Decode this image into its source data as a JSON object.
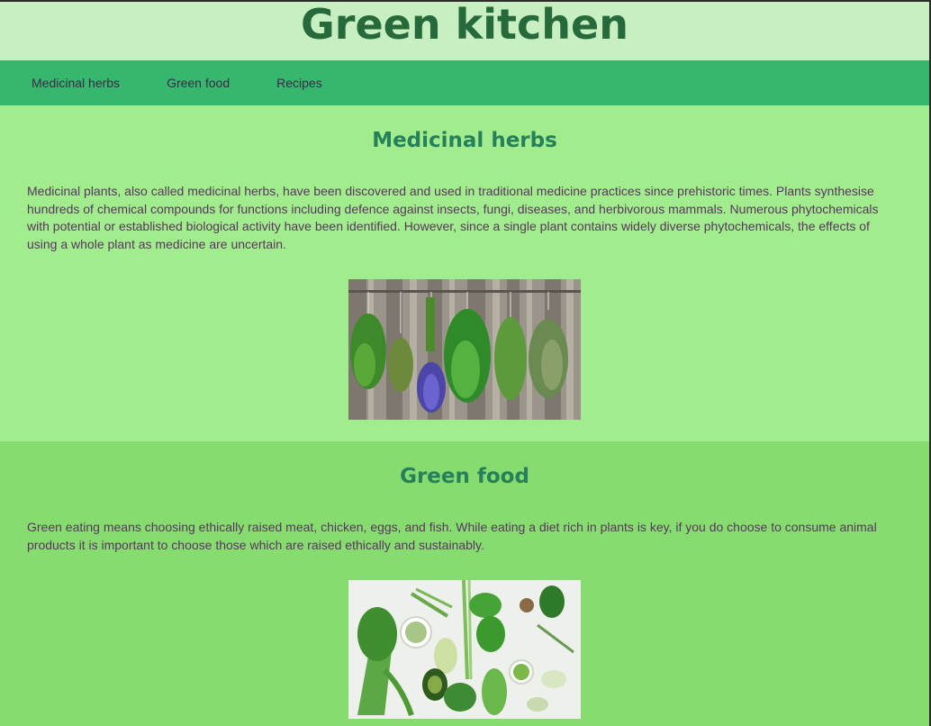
{
  "site": {
    "title": "Green kitchen"
  },
  "nav": {
    "items": [
      {
        "label": "Medicinal herbs"
      },
      {
        "label": "Green food"
      },
      {
        "label": "Recipes"
      }
    ]
  },
  "sections": [
    {
      "title": "Medicinal herbs",
      "text": "Medicinal plants, also called medicinal herbs, have been discovered and used in traditional medicine practices since prehistoric times. Plants synthesise hundreds of chemical compounds for functions including defence against insects, fungi, diseases, and herbivorous mammals. Numerous phytochemicals with potential or established biological activity have been identified. However, since a single plant contains widely diverse phytochemicals, the effects of using a whole plant as medicine are uncertain."
    },
    {
      "title": "Green food",
      "text": "Green eating means choosing ethically raised meat, chicken, eggs, and fish. While eating a diet rich in plants is key, if you do choose to consume animal products it is important to choose those which are raised ethically and sustainably."
    }
  ],
  "colors": {
    "header_bg": "#c7efc1",
    "title": "#26693a",
    "nav_bg": "#37b76d",
    "section_bg_1": "#a1ec8c",
    "section_bg_2": "#87dc70",
    "section_title": "#26805a",
    "body_text": "#5a3560"
  }
}
